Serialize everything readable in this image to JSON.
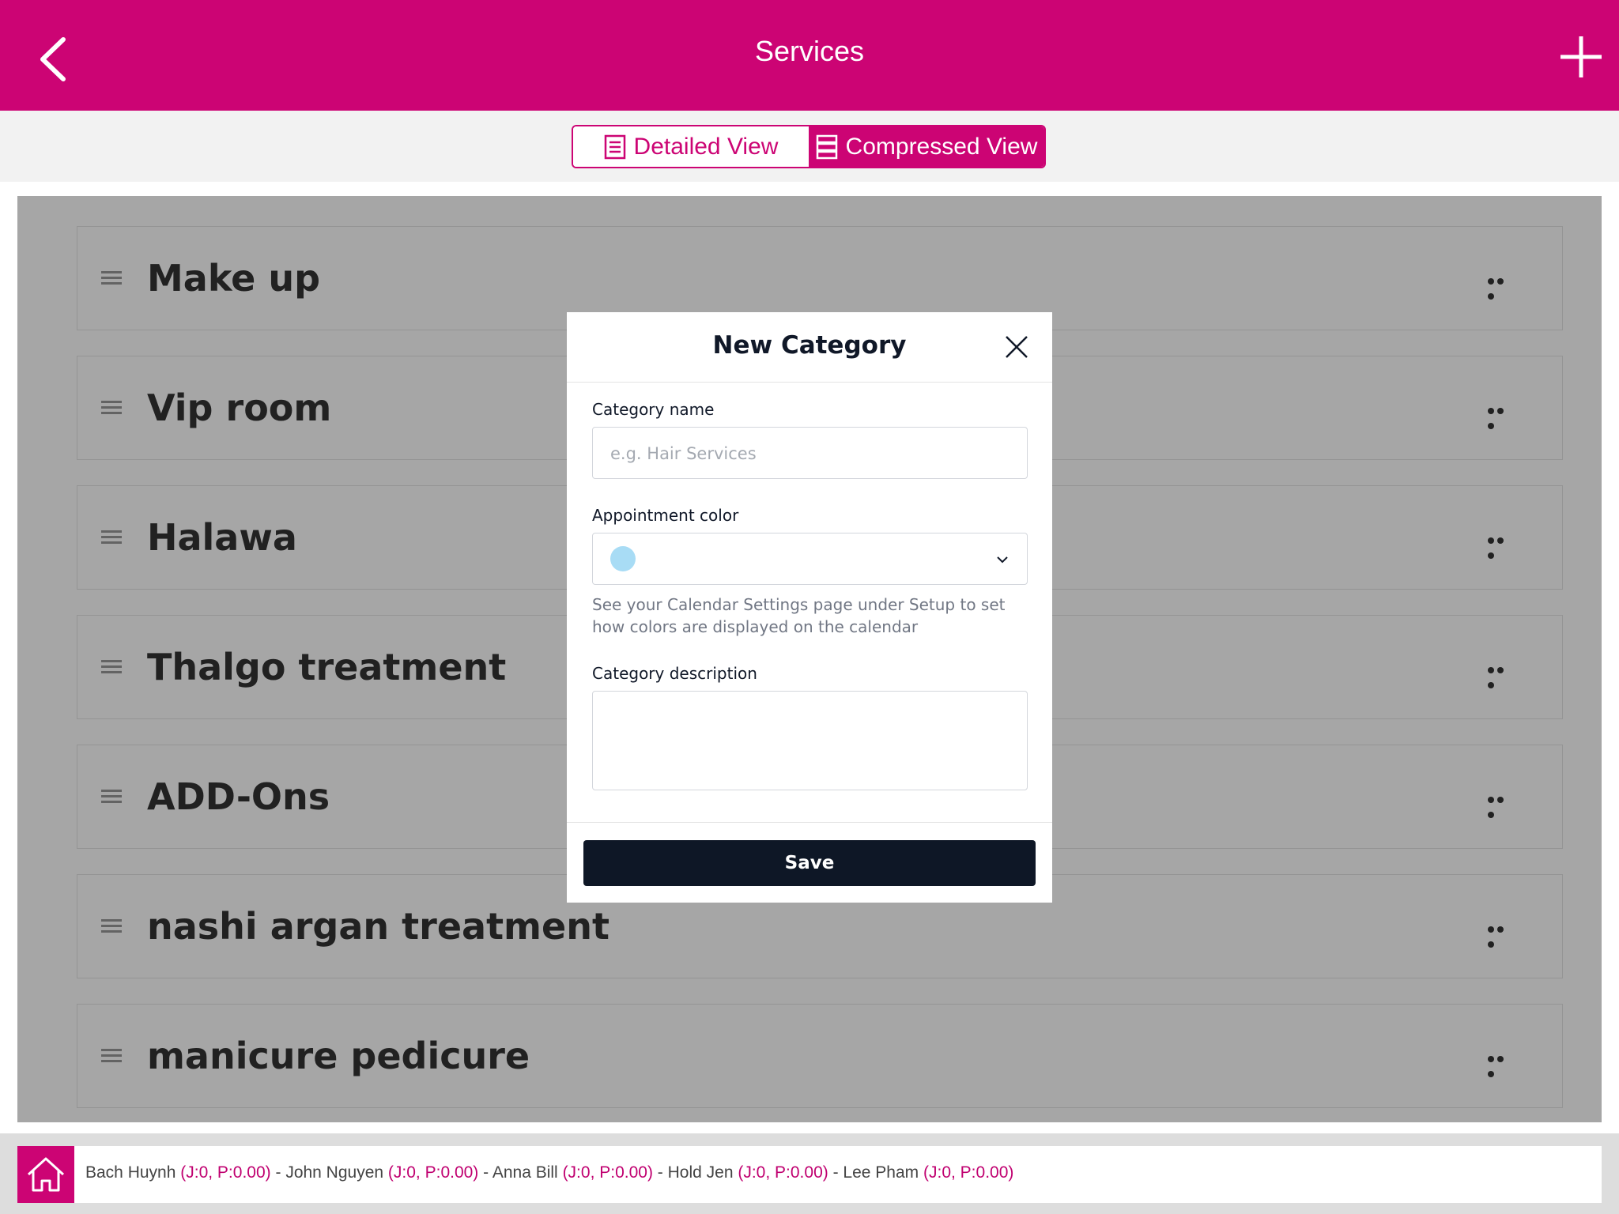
{
  "header": {
    "title": "Services",
    "background_color": "#cc0474"
  },
  "view_toggle": {
    "detailed_label": "Detailed View",
    "compressed_label": "Compressed View",
    "active": "Compressed View"
  },
  "categories": [
    {
      "label": "Make up"
    },
    {
      "label": "Vip room"
    },
    {
      "label": "Halawa"
    },
    {
      "label": "Thalgo treatment"
    },
    {
      "label": "ADD-Ons"
    },
    {
      "label": "nashi argan treatment"
    },
    {
      "label": "manicure pedicure"
    }
  ],
  "modal": {
    "title": "New Category",
    "name_label": "Category name",
    "name_placeholder": "e.g. Hair Services",
    "name_value": "",
    "color_label": "Appointment color",
    "selected_color": "#a8dcf5",
    "color_hint": "See your Calendar Settings page under Setup to set how colors are displayed on the calendar",
    "description_label": "Category description",
    "description_value": "",
    "save_label": "Save"
  },
  "staff_bar": {
    "staff": [
      {
        "name": "Bach Huynh",
        "stat": "(J:0, P:0.00)"
      },
      {
        "name": "John Nguyen",
        "stat": "(J:0, P:0.00)"
      },
      {
        "name": "Anna Bill",
        "stat": "(J:0, P:0.00)"
      },
      {
        "name": "Hold Jen",
        "stat": "(J:0, P:0.00)"
      },
      {
        "name": "Lee Pham",
        "stat": "(J:0, P:0.00)"
      }
    ],
    "separator": " - "
  },
  "icons": {
    "back": "chevron-left-icon",
    "add": "plus-icon",
    "detailed_view": "list-icon",
    "compressed_view": "compressed-list-icon",
    "drag": "drag-handle-icon",
    "more": "more-horizontal-icon",
    "close": "close-icon",
    "dropdown": "chevron-down-icon",
    "home": "home-icon"
  }
}
